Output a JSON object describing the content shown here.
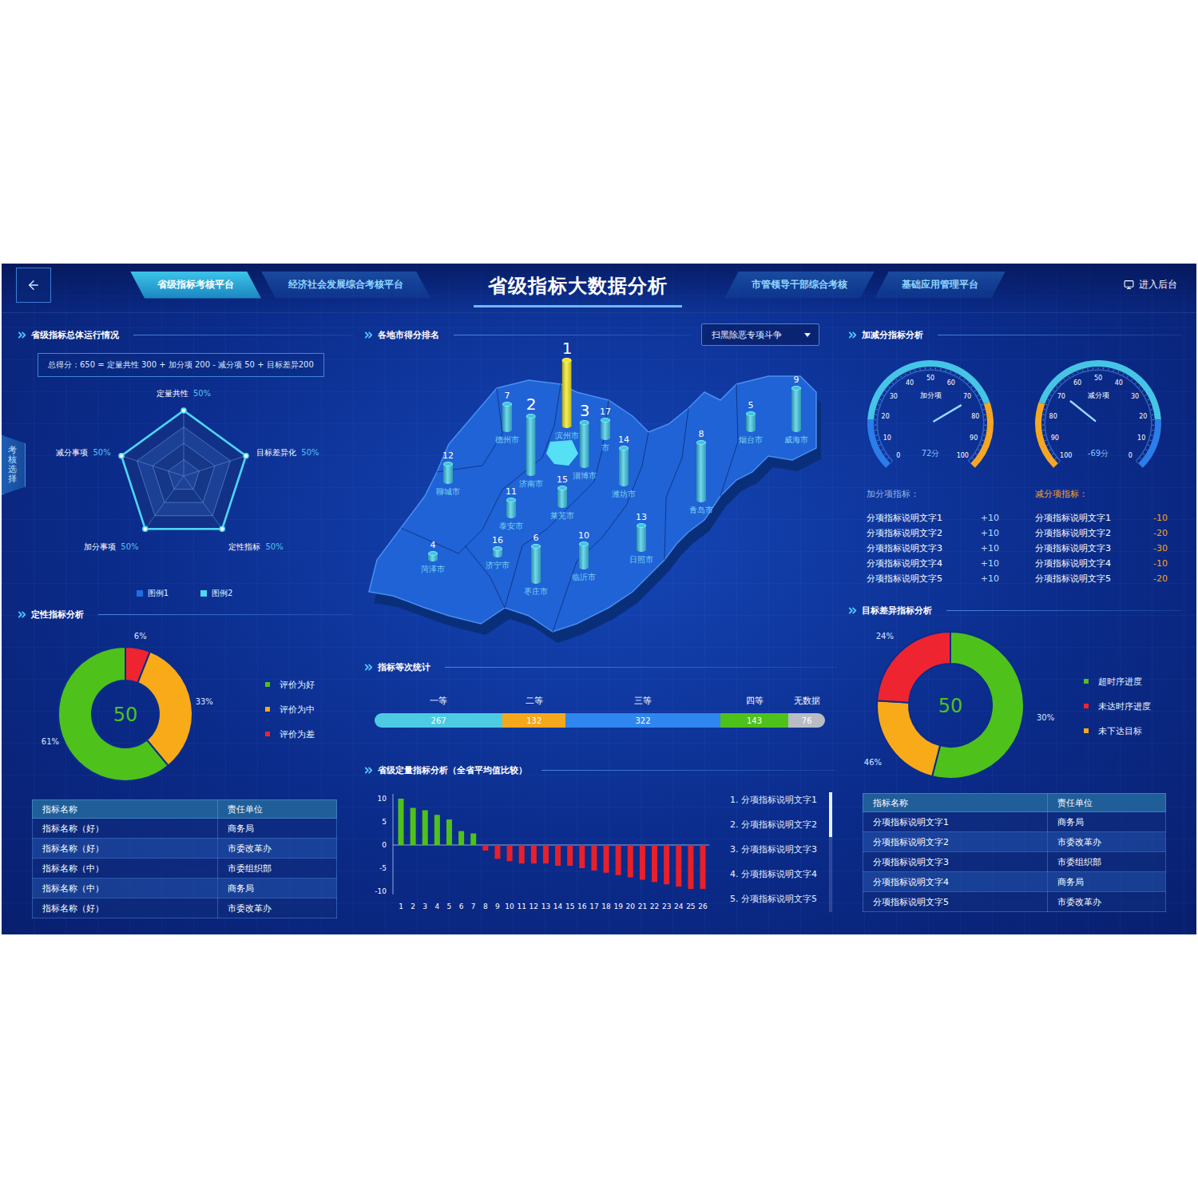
{
  "nav": {
    "left_tabs": [
      {
        "label": "省级指标考核平台",
        "selected": true
      },
      {
        "label": "经济社会发展综合考核平台",
        "selected": false
      }
    ],
    "title": "省级指标大数据分析",
    "right_tabs": [
      {
        "label": "市管领导干部综合考核",
        "selected": false
      },
      {
        "label": "基础应用管理平台",
        "selected": false
      }
    ],
    "admin_link": "进入后台"
  },
  "side_tab": "考核选择",
  "overview": {
    "title": "省级指标总体运行情况",
    "formula": "总得分：650 = 定量共性 300 + 加分项 200 - 减分项 50 + 目标差异200",
    "radar": {
      "axes": [
        {
          "label": "定量共性",
          "share": "50%"
        },
        {
          "label": "目标差异化",
          "share": "50%"
        },
        {
          "label": "定性指标",
          "share": "50%"
        },
        {
          "label": "加分事项",
          "share": "50%"
        },
        {
          "label": "减分事项",
          "share": "50%"
        }
      ],
      "series": [
        {
          "name": "图例1",
          "values": [
            1,
            1,
            1,
            1,
            1
          ],
          "color": "#1f6fe0"
        },
        {
          "name": "图例2",
          "values": [
            1,
            1,
            1,
            1,
            1
          ],
          "color": "#4fd6f0"
        }
      ]
    }
  },
  "ranking": {
    "title": "各地市得分排名",
    "filter": "扫黑除恶专项斗争",
    "cities": [
      {
        "name": "德州市",
        "rank": "7",
        "level": 0.41,
        "color": "#3cc8e4",
        "featured": false
      },
      {
        "name": "滨州市",
        "rank": "1",
        "level": 1.0,
        "color": "#f4e81c",
        "featured": true
      },
      {
        "name": "济南市",
        "rank": "2",
        "level": 0.88,
        "color": "#3cc8e4",
        "featured": true
      },
      {
        "name": "淄博市",
        "rank": "3",
        "level": 0.67,
        "color": "#3cc8e4",
        "featured": true
      },
      {
        "name": "市",
        "rank": "17",
        "level": 0.29,
        "color": "#3cc8e4",
        "featured": false
      },
      {
        "name": "潍坊市",
        "rank": "14",
        "level": 0.56,
        "color": "#3cc8e4",
        "featured": false
      },
      {
        "name": "聊城市",
        "rank": "12",
        "level": 0.29,
        "color": "#3cc8e4",
        "featured": false
      },
      {
        "name": "泰安市",
        "rank": "11",
        "level": 0.27,
        "color": "#3cc8e4",
        "featured": false
      },
      {
        "name": "莱芜市",
        "rank": "15",
        "level": 0.29,
        "color": "#3cc8e4",
        "featured": false
      },
      {
        "name": "青岛市",
        "rank": "8",
        "level": 0.88,
        "color": "#3cc8e4",
        "featured": false
      },
      {
        "name": "烟台市",
        "rank": "5",
        "level": 0.27,
        "color": "#3cc8e4",
        "featured": false
      },
      {
        "name": "威海市",
        "rank": "9",
        "level": 0.65,
        "color": "#3cc8e4",
        "featured": false
      },
      {
        "name": "菏泽市",
        "rank": "4",
        "level": 0.12,
        "color": "#3cc8e4",
        "featured": false
      },
      {
        "name": "济宁市",
        "rank": "16",
        "level": 0.13,
        "color": "#3cc8e4",
        "featured": false
      },
      {
        "name": "枣庄市",
        "rank": "6",
        "level": 0.55,
        "color": "#3cc8e4",
        "featured": false
      },
      {
        "name": "临沂市",
        "rank": "10",
        "level": 0.38,
        "color": "#3cc8e4",
        "featured": false
      },
      {
        "name": "日照市",
        "rank": "13",
        "level": 0.39,
        "color": "#3cc8e4",
        "featured": false
      }
    ]
  },
  "bonus": {
    "title": "加减分指标分析",
    "gauges": [
      {
        "title": "加分项",
        "reading": "72分",
        "kind": "plus",
        "level": 0.72,
        "ticks": [
          "0",
          "10",
          "20",
          "30",
          "40",
          "50",
          "60",
          "70",
          "80",
          "90",
          "100"
        ]
      },
      {
        "title": "减分项",
        "reading": "-69分",
        "kind": "minus",
        "level": 0.31,
        "ticks": [
          "100",
          "90",
          "80",
          "70",
          "60",
          "50",
          "40",
          "30",
          "20",
          "10",
          "0"
        ]
      }
    ],
    "lists": [
      {
        "title": "加分项指标：",
        "kind": "plus",
        "items": [
          {
            "label": "分项指标说明文字1",
            "value": "+10"
          },
          {
            "label": "分项指标说明文字2",
            "value": "+10"
          },
          {
            "label": "分项指标说明文字3",
            "value": "+10"
          },
          {
            "label": "分项指标说明文字4",
            "value": "+10"
          },
          {
            "label": "分项指标说明文字5",
            "value": "+10"
          }
        ]
      },
      {
        "title": "减分项指标：",
        "kind": "minus",
        "items": [
          {
            "label": "分项指标说明文字1",
            "value": "-10"
          },
          {
            "label": "分项指标说明文字2",
            "value": "-20"
          },
          {
            "label": "分项指标说明文字3",
            "value": "-30"
          },
          {
            "label": "分项指标说明文字4",
            "value": "-10"
          },
          {
            "label": "分项指标说明文字5",
            "value": "-20"
          }
        ]
      }
    ]
  },
  "qualitative": {
    "title": "定性指标分析",
    "center": "50",
    "segments": [
      {
        "name": "评价为好",
        "value": 61,
        "label": "61%",
        "color": "#4ec21b"
      },
      {
        "name": "评价为中",
        "value": 33,
        "label": "33%",
        "color": "#f8aa18"
      },
      {
        "name": "评价为差",
        "value": 6,
        "label": "6%",
        "color": "#ee2430"
      }
    ],
    "table": {
      "columns": [
        "指标名称",
        "责任单位"
      ],
      "rows": [
        [
          "指标名称（好）",
          "商务局"
        ],
        [
          "指标名称（好）",
          "市委改革办"
        ],
        [
          "指标名称（中）",
          "市委组织部"
        ],
        [
          "指标名称（中）",
          "商务局"
        ],
        [
          "指标名称（好）",
          "市委改革办"
        ]
      ]
    }
  },
  "grades": {
    "title": "指标等次统计",
    "segments": [
      {
        "name": "一等",
        "value": "267",
        "color": "#4ccbe2"
      },
      {
        "name": "二等",
        "value": "132",
        "color": "#f6a81c"
      },
      {
        "name": "三等",
        "value": "322",
        "color": "#2f86ee"
      },
      {
        "name": "四等",
        "value": "143",
        "color": "#4ec21b"
      },
      {
        "name": "无数据",
        "value": "76",
        "color": "#b9bcc4"
      }
    ]
  },
  "quantitative": {
    "title": "省级定量指标分析（全省平均值比较）",
    "y_ticks": [
      "10",
      "5",
      "0",
      "-5",
      "-10"
    ],
    "x_labels": [
      "1",
      "2",
      "3",
      "4",
      "5",
      "6",
      "7",
      "8",
      "9",
      "10",
      "11",
      "12",
      "13",
      "14",
      "15",
      "16",
      "17",
      "18",
      "19",
      "20",
      "21",
      "22",
      "23",
      "24",
      "25",
      "26"
    ],
    "values": [
      10,
      8,
      7.5,
      6.5,
      5.5,
      3,
      2.5,
      -1.2,
      -3,
      -3.5,
      -4,
      -4,
      -4,
      -4.5,
      -4.5,
      -5,
      -5.5,
      -6,
      -6.5,
      -7,
      -7.5,
      -8,
      -8.5,
      -9,
      -9.5,
      -9.5
    ],
    "legend": [
      "1. 分项指标说明文字1",
      "2. 分项指标说明文字2",
      "3. 分项指标说明文字3",
      "4. 分项指标说明文字4",
      "5. 分项指标说明文字5"
    ]
  },
  "target": {
    "title": "目标差异指标分析",
    "center": "50",
    "segments": [
      {
        "name": "超时序进度",
        "value": 54,
        "label": "30%",
        "color": "#4ec21b"
      },
      {
        "name": "未达时序进度",
        "value": 24,
        "label": "24%",
        "color": "#ee2430"
      },
      {
        "name": "未下达目标",
        "value": 22,
        "label": "46%",
        "color": "#f8aa18"
      }
    ],
    "table": {
      "columns": [
        "指标名称",
        "责任单位"
      ],
      "rows": [
        [
          "分项指标说明文字1",
          "商务局"
        ],
        [
          "分项指标说明文字2",
          "市委改革办"
        ],
        [
          "分项指标说明文字3",
          "市委组织部"
        ],
        [
          "分项指标说明文字4",
          "商务局"
        ],
        [
          "分项指标说明文字5",
          "市委改革办"
        ]
      ]
    }
  }
}
